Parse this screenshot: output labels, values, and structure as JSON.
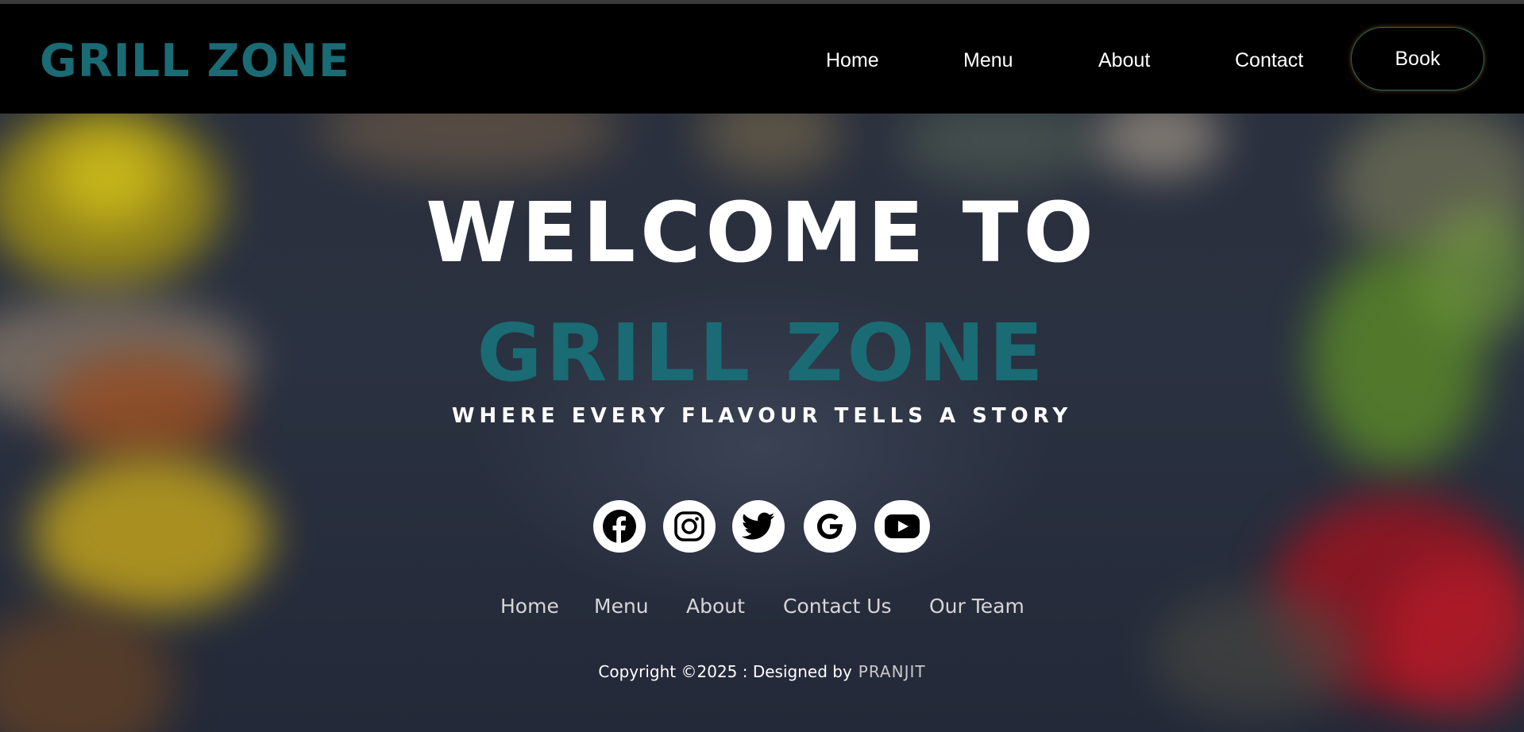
{
  "header": {
    "logo": "GRILL ZONE",
    "nav": [
      "Home",
      "Menu",
      "About",
      "Contact"
    ],
    "book_label": "Book"
  },
  "hero": {
    "welcome": "WELCOME TO",
    "brand": "GRILL ZONE",
    "tagline": "WHERE EVERY FLAVOUR TELLS A STORY"
  },
  "social": [
    "facebook-icon",
    "instagram-icon",
    "twitter-icon",
    "google-icon",
    "youtube-icon"
  ],
  "footer": {
    "links": [
      "Home",
      "Menu",
      "About",
      "Contact Us",
      "Our Team"
    ],
    "copyright": "Copyright ©2025 : Designed by",
    "designer": "PRANJIT"
  },
  "colors": {
    "brand_teal": "#1a6b73",
    "navbar": "#000000",
    "text_light": "#ffffff"
  }
}
